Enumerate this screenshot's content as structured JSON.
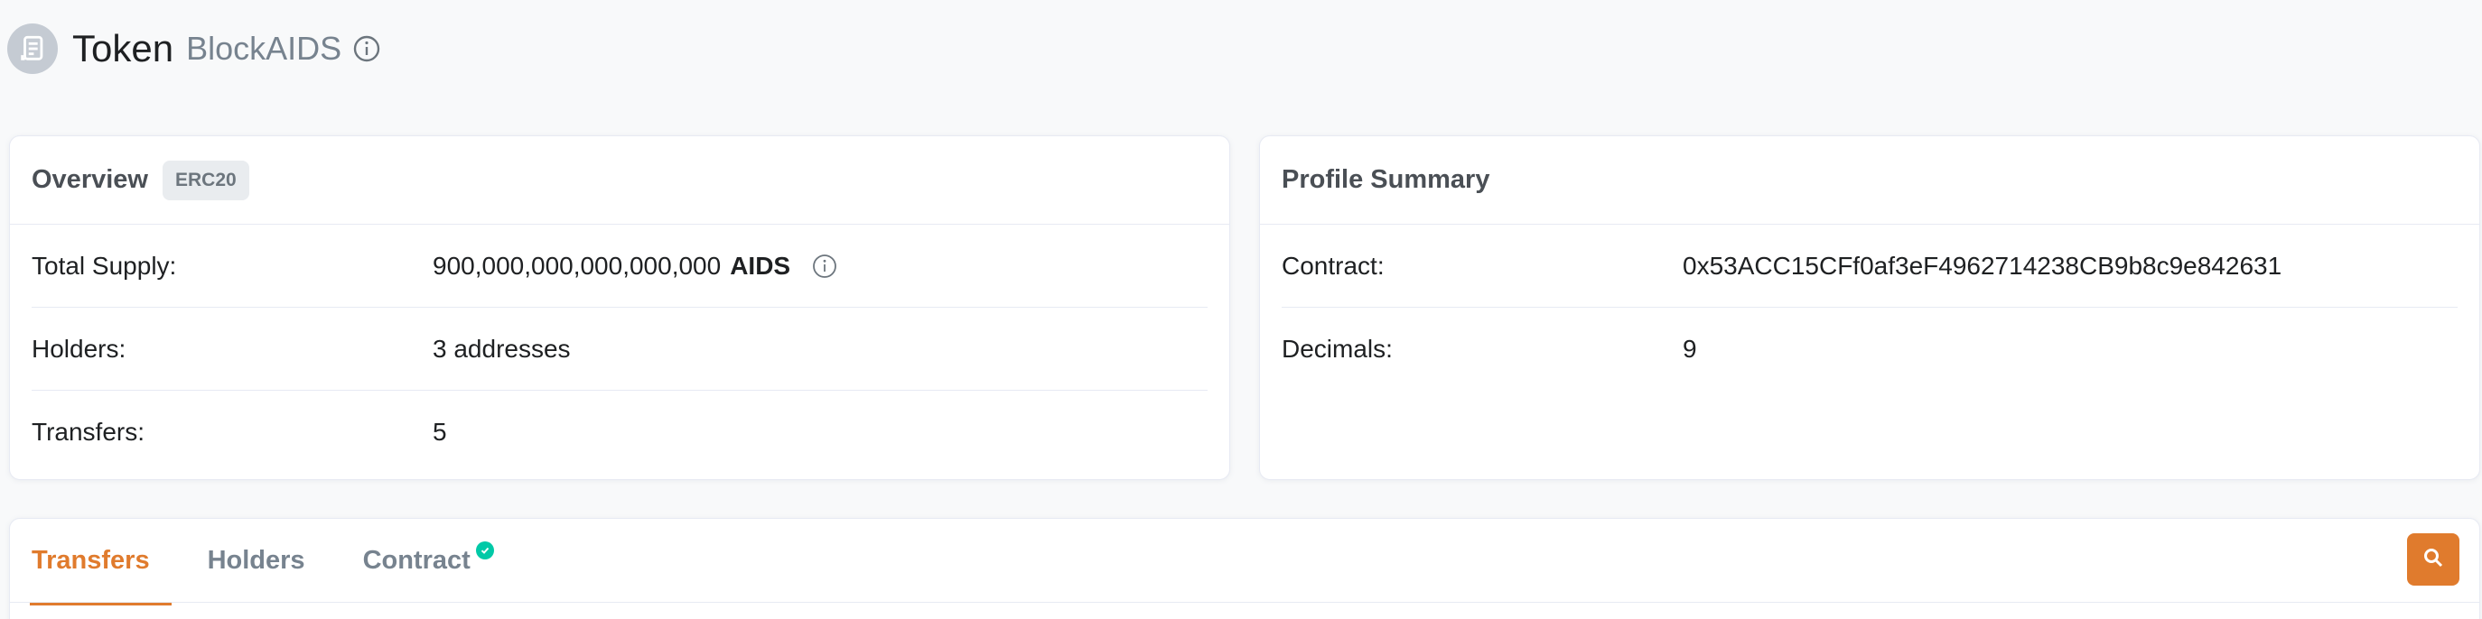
{
  "header": {
    "title": "Token",
    "subtitle": "BlockAIDS",
    "logo_icon": "token-document-icon",
    "info_icon": "info-circle-icon"
  },
  "overview": {
    "title": "Overview",
    "badge": "ERC20",
    "rows": [
      {
        "label": "Total Supply:",
        "value": "900,000,000,000,000,000",
        "unit": "AIDS"
      },
      {
        "label": "Holders:",
        "value": "3 addresses"
      },
      {
        "label": "Transfers:",
        "value": "5"
      }
    ]
  },
  "profile": {
    "title": "Profile Summary",
    "rows": [
      {
        "label": "Contract:",
        "value": "0x53ACC15CFf0af3eF4962714238CB9b8c9e842631"
      },
      {
        "label": "Decimals:",
        "value": "9"
      }
    ]
  },
  "tabs": [
    {
      "label": "Transfers",
      "active": true
    },
    {
      "label": "Holders",
      "active": false
    },
    {
      "label": "Contract",
      "active": false,
      "verified": true
    }
  ],
  "colors": {
    "accent": "#e07b2d",
    "verified": "#00c9a7",
    "muted": "#77838f"
  }
}
